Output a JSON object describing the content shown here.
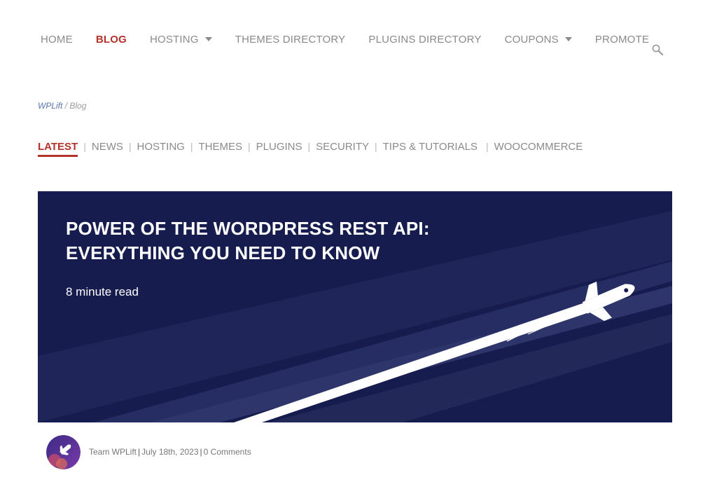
{
  "nav": {
    "items": [
      {
        "label": "HOME"
      },
      {
        "label": "BLOG"
      },
      {
        "label": "HOSTING"
      },
      {
        "label": "THEMES DIRECTORY"
      },
      {
        "label": "PLUGINS DIRECTORY"
      },
      {
        "label": "COUPONS"
      },
      {
        "label": "PROMOTE"
      }
    ],
    "active": "BLOG",
    "search_icon": "search-icon"
  },
  "breadcrumb": {
    "home": "WPLift",
    "separator": " / ",
    "current": "Blog"
  },
  "categories": {
    "items": [
      {
        "label": "LATEST"
      },
      {
        "label": "NEWS"
      },
      {
        "label": "HOSTING"
      },
      {
        "label": "THEMES"
      },
      {
        "label": "PLUGINS"
      },
      {
        "label": "SECURITY"
      },
      {
        "label": "TIPS & TUTORIALS"
      },
      {
        "label": "WOOCOMMERCE"
      }
    ],
    "separator": "|",
    "active": "LATEST"
  },
  "post": {
    "title_line1": "POWER OF THE WORDPRESS REST API:",
    "title_line2": "EVERYTHING YOU NEED TO KNOW",
    "read_time": "8 minute read",
    "author": "Team WPLift",
    "date": "July 18th, 2023",
    "comments": "0 Comments",
    "meta_separator": "|"
  },
  "colors": {
    "accent": "#b5322a",
    "hero_bg": "#171c4e",
    "nav_text": "#8a8a8a",
    "breadcrumb_link": "#5b74b0"
  }
}
